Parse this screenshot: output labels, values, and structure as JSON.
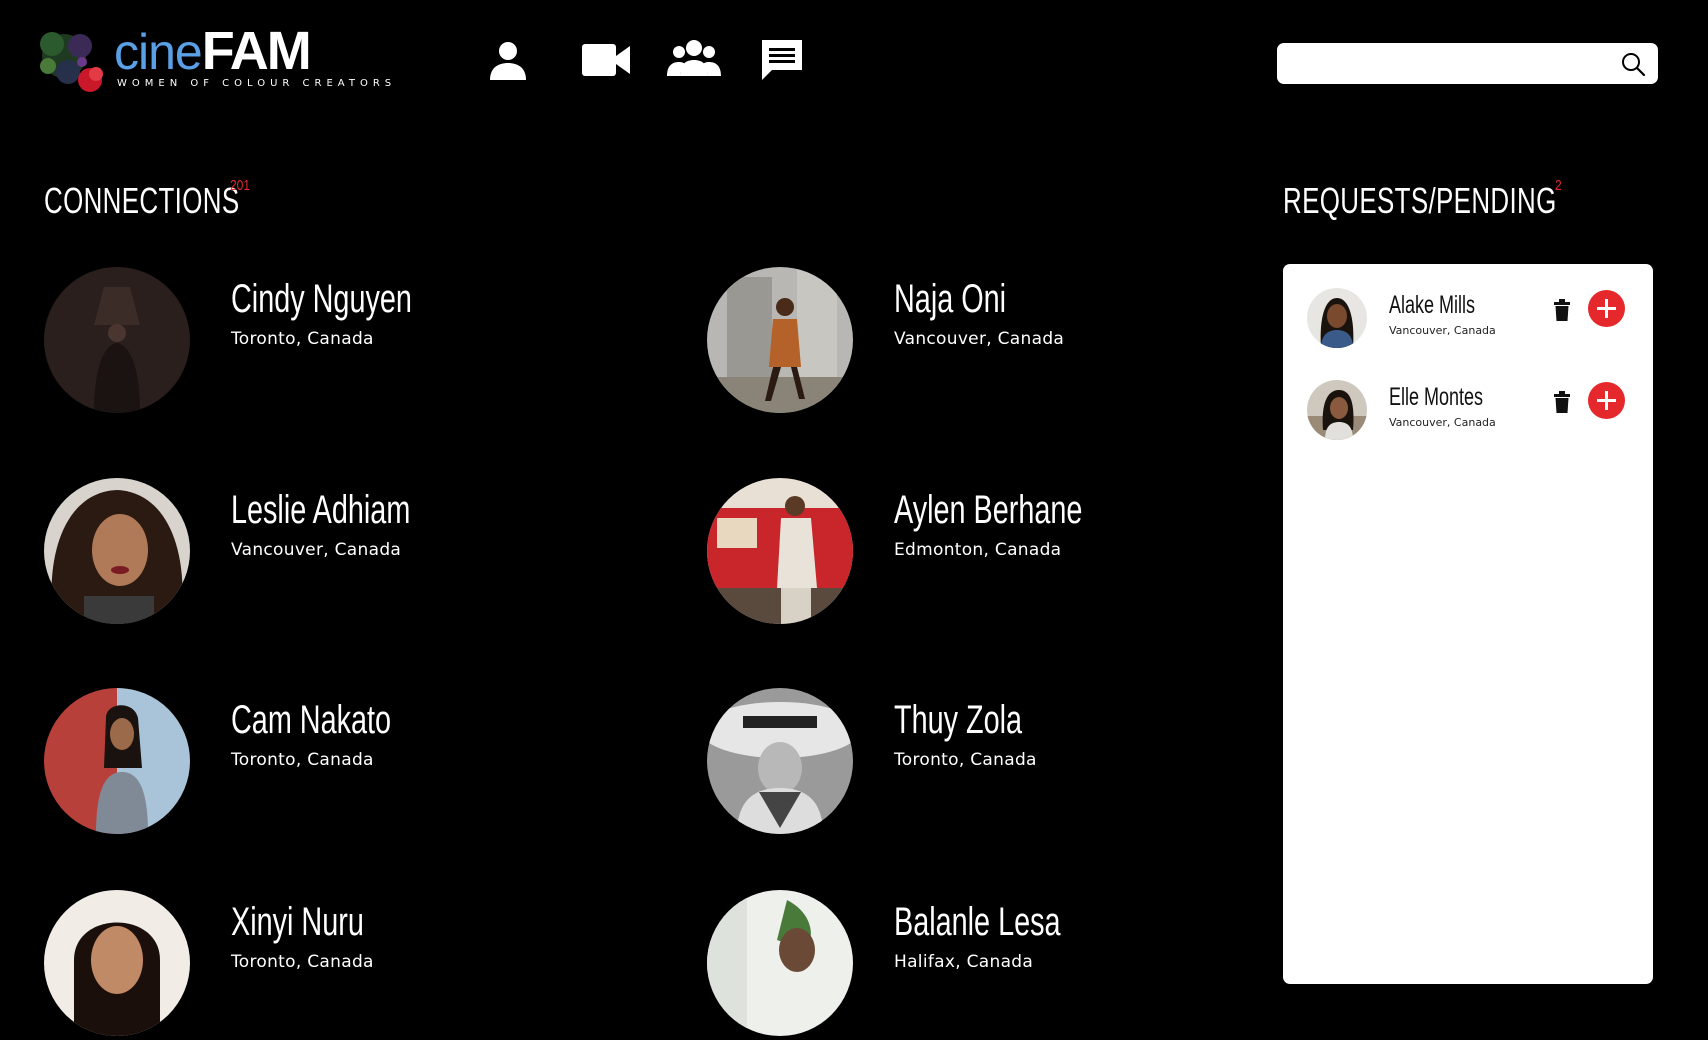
{
  "brand": {
    "logo_part1": "cine",
    "logo_part2": "FAM",
    "tagline": "WOMEN OF COLOUR CREATORS"
  },
  "nav": {
    "icons": [
      "profile-icon",
      "video-camera-icon",
      "people-icon",
      "chat-icon"
    ]
  },
  "search": {
    "placeholder": "",
    "value": "",
    "icon": "search-icon"
  },
  "connections": {
    "title": "CONNECTIONS",
    "count": "201",
    "items": [
      {
        "name": "Cindy Nguyen",
        "location": "Toronto, Canada"
      },
      {
        "name": "Naja Oni",
        "location": "Vancouver, Canada"
      },
      {
        "name": "Leslie Adhiam",
        "location": "Vancouver, Canada"
      },
      {
        "name": "Aylen Berhane",
        "location": "Edmonton, Canada"
      },
      {
        "name": "Cam Nakato",
        "location": "Toronto, Canada"
      },
      {
        "name": "Thuy Zola",
        "location": "Toronto, Canada"
      },
      {
        "name": "Xinyi Nuru",
        "location": "Toronto, Canada"
      },
      {
        "name": "Balanle Lesa",
        "location": "Halifax, Canada"
      }
    ]
  },
  "requests": {
    "title": "REQUESTS/PENDING",
    "count": "2",
    "items": [
      {
        "name": "Alake Mills",
        "location": "Vancouver, Canada"
      },
      {
        "name": "Elle Montes",
        "location": "Vancouver, Canada"
      }
    ]
  },
  "colors": {
    "background": "#000000",
    "accent_red": "#e5282b",
    "logo_blue": "#5aa0e6",
    "panel": "#ffffff"
  }
}
